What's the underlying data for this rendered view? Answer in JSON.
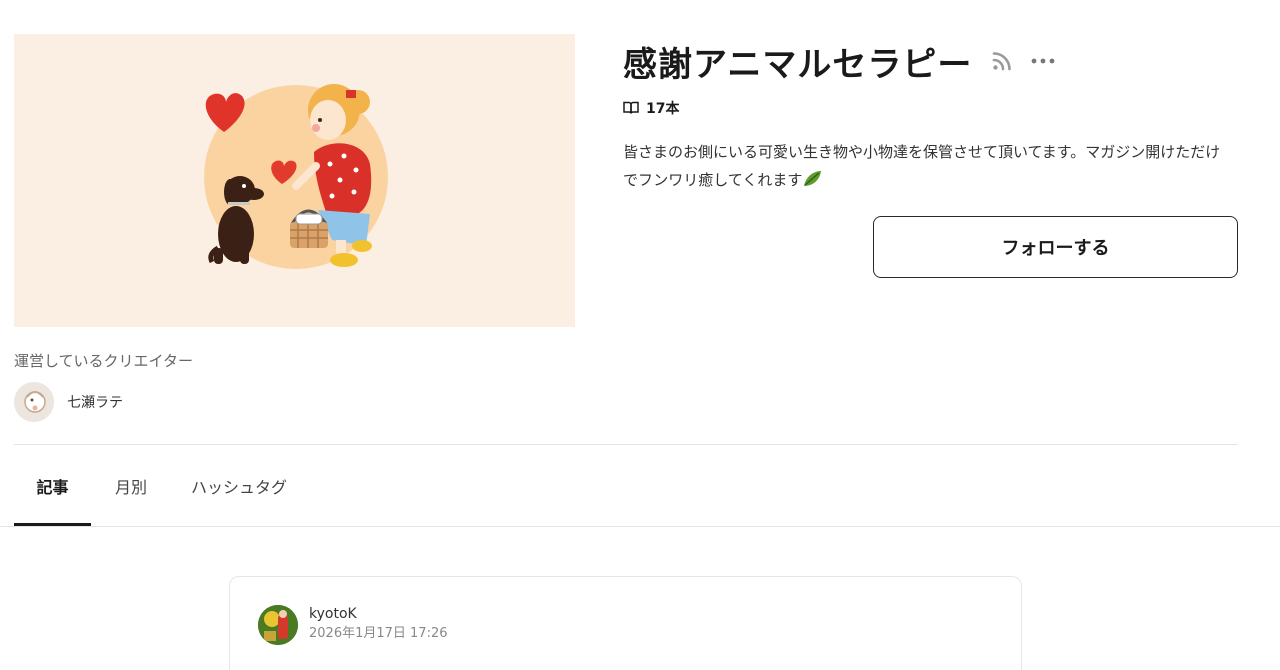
{
  "magazine": {
    "title": "感謝アニマルセラピー",
    "article_count": "17本",
    "description": "皆さまのお側にいる可愛い生き物や小物達を保管させて頂いてます。マガジン開けただけでフンワリ癒してくれます",
    "follow_label": "フォローする",
    "icons": {
      "rss": "rss-icon",
      "more": "more-icon",
      "book": "book-icon",
      "leaf": "leaf-icon"
    }
  },
  "creator": {
    "section_label": "運営しているクリエイター",
    "name": "七瀬ラテ"
  },
  "tabs": [
    {
      "label": "記事",
      "active": true
    },
    {
      "label": "月別",
      "active": false
    },
    {
      "label": "ハッシュタグ",
      "active": false
    }
  ],
  "article": {
    "author": "kyotoK",
    "date": "2026年1月17日 17:26"
  },
  "colors": {
    "cover_background": "#fbeee2",
    "accent_text": "#1a1a1a",
    "divider": "#e4e4e4"
  }
}
